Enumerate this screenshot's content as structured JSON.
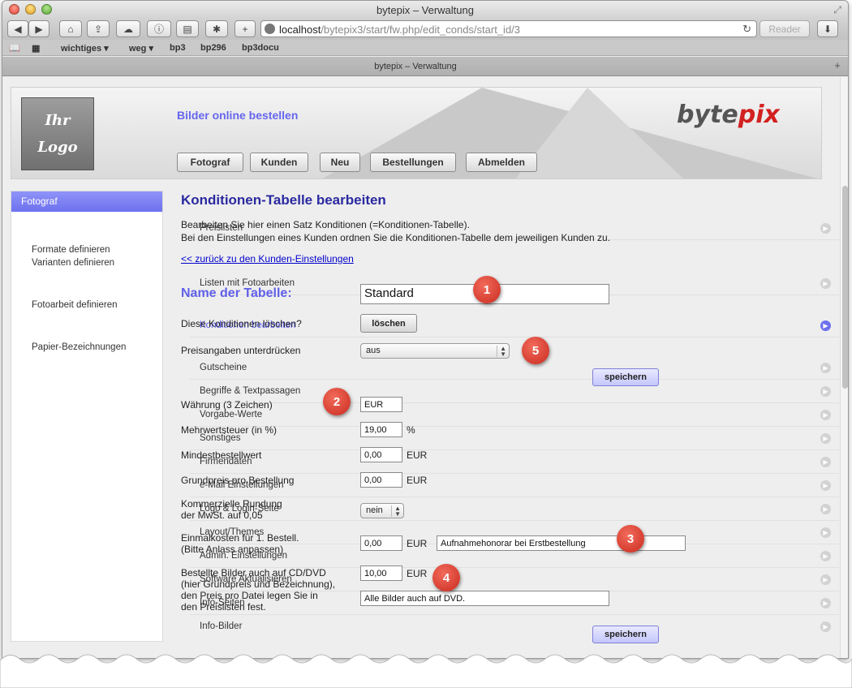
{
  "window": {
    "title": "bytepix – Verwaltung"
  },
  "browser": {
    "url_host": "localhost",
    "url_path": "/bytepix3/start/fw.php/edit_conds/start_id/3",
    "reader_label": "Reader",
    "bookmarks": [
      "wichtiges",
      "weg",
      "bp3",
      "bp296",
      "bp3docu"
    ],
    "tab_title": "bytepix – Verwaltung"
  },
  "header": {
    "logo_line1": "Ihr",
    "logo_line2": "Logo",
    "tagline": "Bilder online bestellen",
    "brand_part1": "byte",
    "brand_part2": "pix",
    "nav": [
      "Fotograf",
      "Kunden",
      "Neu",
      "Bestellungen",
      "Abmelden"
    ]
  },
  "sidebar": {
    "heading": "Fotograf",
    "items": {
      "preislisten": "Preislisten",
      "formate": "Formate definieren",
      "varianten": "Varianten definieren",
      "listen": "Listen mit Fotoarbeiten",
      "fotoarbeit": "Fotoarbeit definieren",
      "konditionen": "Konditionen bearbeiten",
      "papier": "Papier-Bezeichnungen",
      "gutscheine": "Gutscheine",
      "begriffe": "Begriffe & Textpassagen",
      "vorgabe": "Vorgabe-Werte",
      "sonstiges": "Sonstiges",
      "firmendaten": "Firmendaten",
      "email": "e-Mail Einstellungen",
      "logo": "Logo & Login-Seite",
      "layout": "Layout/Themes",
      "admin": "Admin. Einstellungen",
      "software": "Software Aktualisieren",
      "infoseiten": "Info-Seiten",
      "infobilder": "Info-Bilder"
    }
  },
  "main": {
    "title": "Konditionen-Tabelle bearbeiten",
    "intro_line1": "Bearbeiten Sie hier einen Satz Konditionen (=Konditionen-Tabelle).",
    "intro_line2": "Bei den Einstellungen eines Kunden ordnen Sie die Konditionen-Tabelle dem jeweiligen Kunden zu.",
    "back_link": "<< zurück zu den Kunden-Einstellungen",
    "table_name_label": "Name der Tabelle:",
    "table_name_value": "Standard",
    "delete_label": "Diese Konditionen löschen?",
    "delete_button": "löschen",
    "suppress_label": "Preisangaben unterdrücken",
    "suppress_value": "aus",
    "save_button": "speichern",
    "currency_label": "Währung (3 Zeichen)",
    "currency_value": "EUR",
    "vat_label": "Mehrwertsteuer (in %)",
    "vat_value": "19,00",
    "vat_unit": "%",
    "minorder_label": "Mindestbestellwert",
    "minorder_value": "0,00",
    "minorder_unit": "EUR",
    "base_label": "Grundpreis pro Bestellung",
    "base_value": "0,00",
    "base_unit": "EUR",
    "rounding_label_line1": "Kommerzielle Rundung",
    "rounding_label_line2": "der MwSt. auf 0,05",
    "rounding_value": "nein",
    "onetime_label_line1": "Einmalkosten für 1. Bestell.",
    "onetime_label_line2": "(Bitte Anlass anpassen)",
    "onetime_value": "0,00",
    "onetime_unit": "EUR",
    "onetime_desc": "Aufnahmehonorar bei Erstbestellung",
    "cd_label_line1": "Bestellte Bilder auch auf CD/DVD",
    "cd_label_line2": "(hier Grundpreis und Bezeichnung),",
    "cd_label_line3": "den Preis pro Datei legen Sie in",
    "cd_label_line4": "den Preislisten fest.",
    "cd_value": "10,00",
    "cd_unit": "EUR",
    "cd_desc": "Alle Bilder auch auf DVD."
  },
  "markers": [
    "1",
    "2",
    "3",
    "4",
    "5"
  ]
}
